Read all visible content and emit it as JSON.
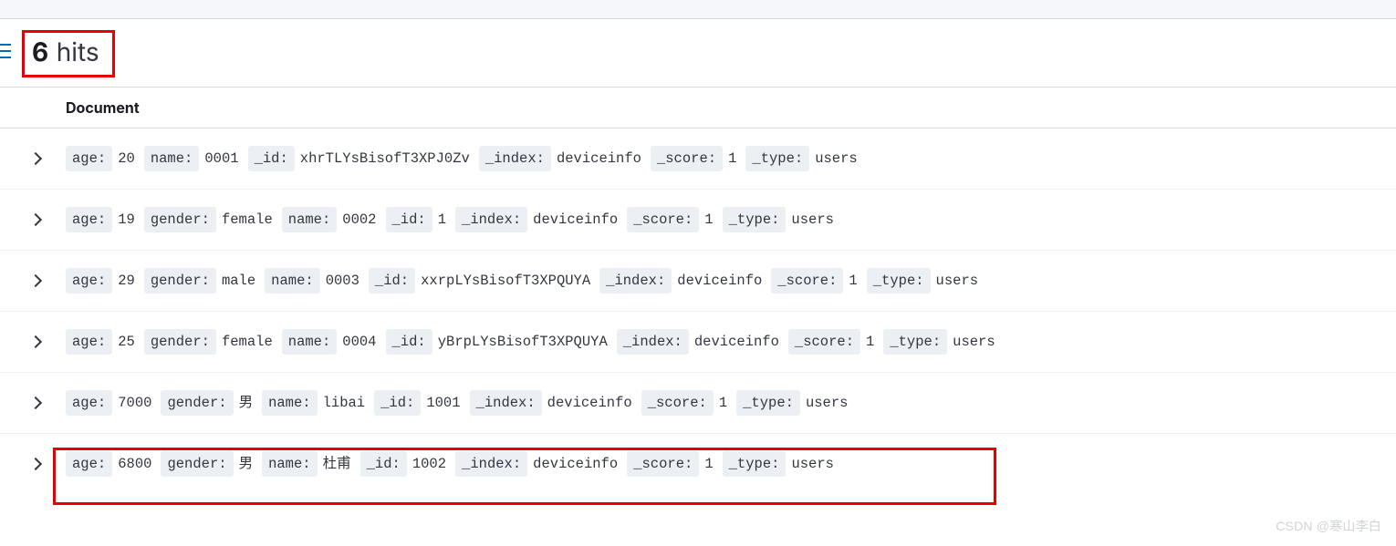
{
  "header": {
    "hits_count": "6",
    "hits_label": "hits"
  },
  "columns": {
    "document": "Document"
  },
  "rows": [
    {
      "fields": [
        {
          "key": "age:",
          "val": "20"
        },
        {
          "key": "name:",
          "val": "0001"
        },
        {
          "key": "_id:",
          "val": "xhrTLYsBisofT3XPJ0Zv"
        },
        {
          "key": "_index:",
          "val": "deviceinfo"
        },
        {
          "key": "_score:",
          "val": "1"
        },
        {
          "key": "_type:",
          "val": "users"
        }
      ]
    },
    {
      "fields": [
        {
          "key": "age:",
          "val": "19"
        },
        {
          "key": "gender:",
          "val": "female"
        },
        {
          "key": "name:",
          "val": "0002"
        },
        {
          "key": "_id:",
          "val": "1"
        },
        {
          "key": "_index:",
          "val": "deviceinfo"
        },
        {
          "key": "_score:",
          "val": "1"
        },
        {
          "key": "_type:",
          "val": "users"
        }
      ]
    },
    {
      "fields": [
        {
          "key": "age:",
          "val": "29"
        },
        {
          "key": "gender:",
          "val": "male"
        },
        {
          "key": "name:",
          "val": "0003"
        },
        {
          "key": "_id:",
          "val": "xxrpLYsBisofT3XPQUYA"
        },
        {
          "key": "_index:",
          "val": "deviceinfo"
        },
        {
          "key": "_score:",
          "val": "1"
        },
        {
          "key": "_type:",
          "val": "users"
        }
      ]
    },
    {
      "fields": [
        {
          "key": "age:",
          "val": "25"
        },
        {
          "key": "gender:",
          "val": "female"
        },
        {
          "key": "name:",
          "val": "0004"
        },
        {
          "key": "_id:",
          "val": "yBrpLYsBisofT3XPQUYA"
        },
        {
          "key": "_index:",
          "val": "deviceinfo"
        },
        {
          "key": "_score:",
          "val": "1"
        },
        {
          "key": "_type:",
          "val": "users"
        }
      ]
    },
    {
      "fields": [
        {
          "key": "age:",
          "val": "7000"
        },
        {
          "key": "gender:",
          "val": "男"
        },
        {
          "key": "name:",
          "val": "libai"
        },
        {
          "key": "_id:",
          "val": "1001"
        },
        {
          "key": "_index:",
          "val": "deviceinfo"
        },
        {
          "key": "_score:",
          "val": "1"
        },
        {
          "key": "_type:",
          "val": "users"
        }
      ]
    },
    {
      "fields": [
        {
          "key": "age:",
          "val": "6800"
        },
        {
          "key": "gender:",
          "val": "男"
        },
        {
          "key": "name:",
          "val": "杜甫"
        },
        {
          "key": "_id:",
          "val": "1002"
        },
        {
          "key": "_index:",
          "val": "deviceinfo"
        },
        {
          "key": "_score:",
          "val": "1"
        },
        {
          "key": "_type:",
          "val": "users"
        }
      ]
    }
  ],
  "watermark": "CSDN @寒山李白"
}
